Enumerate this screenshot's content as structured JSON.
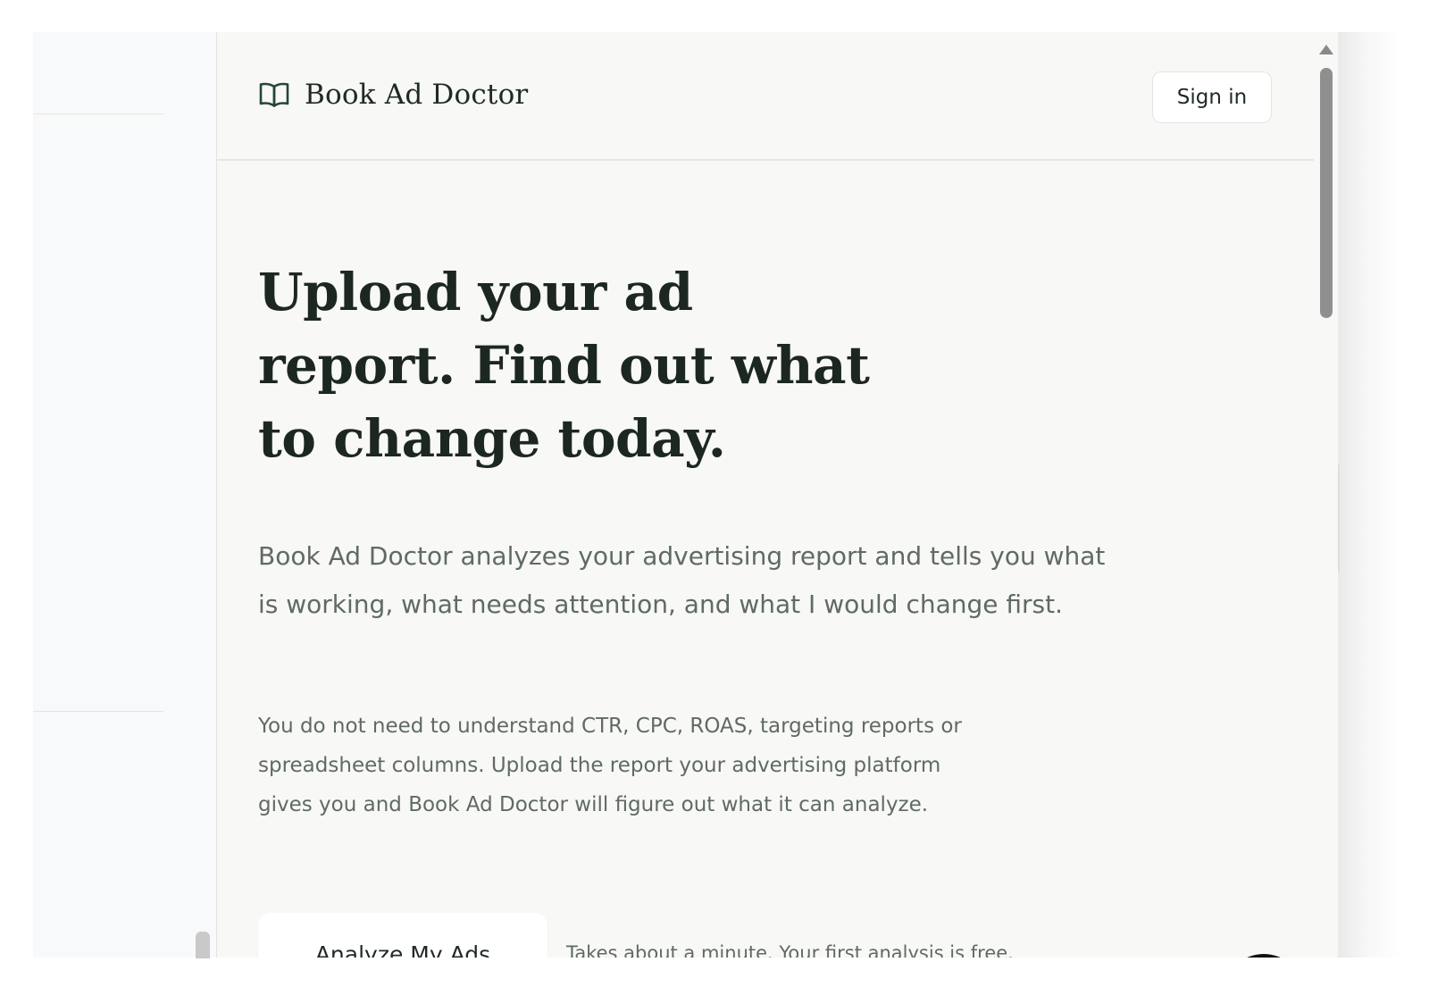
{
  "header": {
    "brand_name": "Book Ad Doctor",
    "brand_icon": "open-book-icon",
    "signin_label": "Sign in"
  },
  "hero": {
    "title_lines": [
      "Upload your ad",
      "report. Find out what",
      "to change today."
    ],
    "lead": "Book Ad Doctor analyzes your advertising report and tells you what is working, what needs attention, and what I would change first.",
    "sub": "You do not need to understand CTR, CPC, ROAS, targeting reports or spreadsheet columns. Upload the report your advertising platform gives you and Book Ad Doctor will figure out what it can analyze.",
    "cta_label": "Analyze My Ads",
    "cta_note": "Takes about a minute. Your first analysis is free."
  },
  "widgets": {
    "chat_icon": "chat-bubble-icon"
  },
  "colors": {
    "page_bg": "#f8f8f6",
    "text_dark": "#1c2722",
    "text_muted": "#5f6a66",
    "chat_bg": "#111111"
  }
}
